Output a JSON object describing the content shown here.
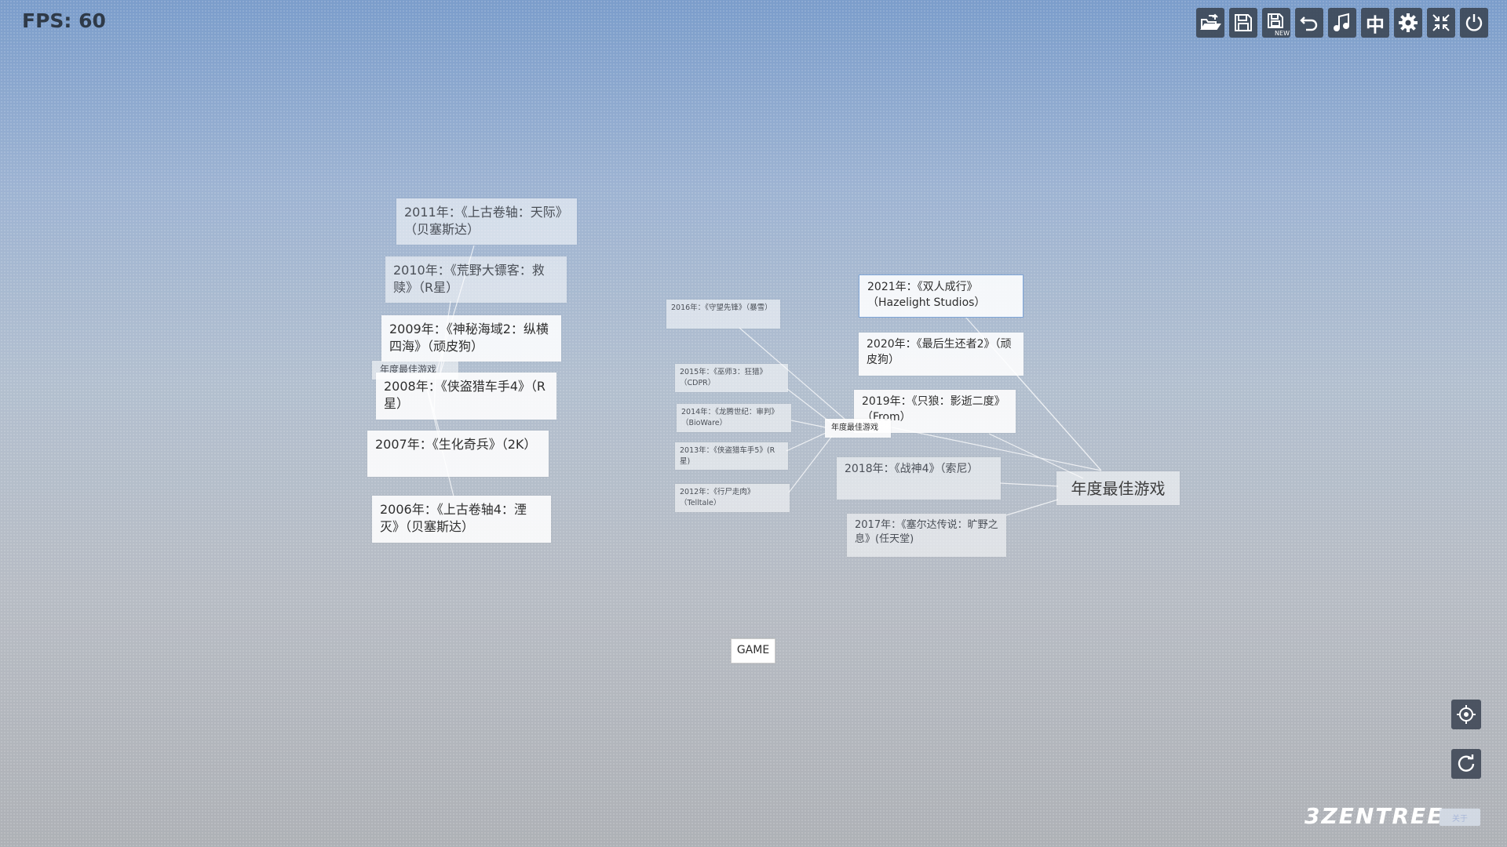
{
  "fps_label": "FPS: 60",
  "toolbar": {
    "buttons": [
      {
        "name": "open-icon"
      },
      {
        "name": "save-icon"
      },
      {
        "name": "save-new-icon",
        "badge": "NEW"
      },
      {
        "name": "undo-icon"
      },
      {
        "name": "music-icon"
      },
      {
        "name": "language-icon",
        "text": "中"
      },
      {
        "name": "gear-icon"
      },
      {
        "name": "collapse-icon"
      },
      {
        "name": "power-icon"
      }
    ]
  },
  "mindmap": {
    "root": "年度最佳游戏",
    "right_nodes": [
      "2021年：《双人成行》（Hazelight Studios）",
      "2020年：《最后生还者2》（顽皮狗）",
      "2019年：《只狼：影逝二度》（From）",
      "2018年：《战神4》（索尼）",
      "2017年：《塞尔达传说：旷野之息》(任天堂)"
    ],
    "middle_nodes": [
      "2016年：《守望先锋》（暴雪）",
      "2015年：《巫师3：狂猎》（CDPR）",
      "2014年：《龙腾世纪：审判》（BioWare）",
      "2013年：《侠盗猎车手5》(R星)",
      "2012年：《行尸走肉》（Telltale）"
    ],
    "middle_hub": "年度最佳游戏",
    "left_nodes": [
      "2011年：《上古卷轴：天际》（贝塞斯达）",
      "2010年：《荒野大镖客：救赎》（R星）",
      "2009年：《神秘海域2：纵横四海》（顽皮狗）",
      "2008年：《侠盗猎车手4》（R星）",
      "2007年：《生化奇兵》（2K）",
      "2006年：《上古卷轴4：湮灭》（贝塞斯达）"
    ],
    "left_hub": "年度最佳游戏",
    "game_node": "GAME"
  },
  "side_buttons": [
    {
      "name": "locate-icon"
    },
    {
      "name": "refresh-icon"
    }
  ],
  "brand": "3ZENTREE",
  "about_label": "关于",
  "colors": {
    "toolbar_bg": "#3a4452",
    "node_bg": "#ffffff",
    "line": "#ffffff"
  }
}
